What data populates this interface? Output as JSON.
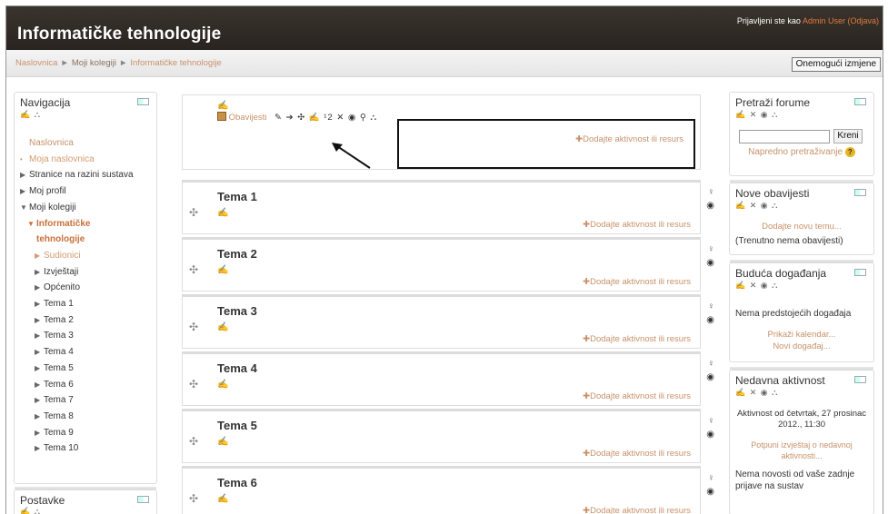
{
  "header": {
    "site_title": "Informatičke tehnologije",
    "login_prefix": "Prijavljeni ste kao",
    "login_user": "Admin User",
    "logout_label": "(Odjava)"
  },
  "navbar": {
    "breadcrumb": [
      "Naslovnica",
      "Moji kolegiji",
      "Informatičke tehnologije"
    ],
    "breadcrumb_sep": "►",
    "edit_button": "Onemogući izmjene"
  },
  "navigation_block": {
    "title": "Navigacija",
    "icons": "✍ ⛬",
    "items": [
      {
        "label": "Naslovnica",
        "indent": 0,
        "marker": "",
        "style": "link"
      },
      {
        "label": "Moja naslovnica",
        "indent": 0,
        "marker": "•",
        "style": "muted"
      },
      {
        "label": "Stranice na razini sustava",
        "indent": 0,
        "marker": "▶",
        "style": "text"
      },
      {
        "label": "Moj profil",
        "indent": 0,
        "marker": "▶",
        "style": "text"
      },
      {
        "label": "Moji kolegiji",
        "indent": 0,
        "marker": "▼",
        "style": "text"
      },
      {
        "label": "Informatičke",
        "indent": 1,
        "marker": "▼",
        "style": "bold-link"
      },
      {
        "label": "tehnologije",
        "indent": 1,
        "marker": "",
        "style": "bold-link"
      },
      {
        "label": "Sudionici",
        "indent": 2,
        "marker": "▶",
        "style": "muted"
      },
      {
        "label": "Izvještaji",
        "indent": 2,
        "marker": "▶",
        "style": "text"
      },
      {
        "label": "Općenito",
        "indent": 2,
        "marker": "▶",
        "style": "text"
      },
      {
        "label": "Tema 1",
        "indent": 2,
        "marker": "▶",
        "style": "text"
      },
      {
        "label": "Tema 2",
        "indent": 2,
        "marker": "▶",
        "style": "text"
      },
      {
        "label": "Tema 3",
        "indent": 2,
        "marker": "▶",
        "style": "text"
      },
      {
        "label": "Tema 4",
        "indent": 2,
        "marker": "▶",
        "style": "text"
      },
      {
        "label": "Tema 5",
        "indent": 2,
        "marker": "▶",
        "style": "text"
      },
      {
        "label": "Tema 6",
        "indent": 2,
        "marker": "▶",
        "style": "text"
      },
      {
        "label": "Tema 7",
        "indent": 2,
        "marker": "▶",
        "style": "text"
      },
      {
        "label": "Tema 8",
        "indent": 2,
        "marker": "▶",
        "style": "text"
      },
      {
        "label": "Tema 9",
        "indent": 2,
        "marker": "▶",
        "style": "text"
      },
      {
        "label": "Tema 10",
        "indent": 2,
        "marker": "▶",
        "style": "text"
      }
    ]
  },
  "settings_block": {
    "title": "Postavke"
  },
  "intro_section": {
    "pencil": "✍",
    "forum_link": "Obavijesti",
    "forum_icons": "✎ ➔ ✣ ✍ ¹2 ✕ ◉ ⚲ ⛬",
    "add_activity": "✚Dodajte aktivnost ili resurs"
  },
  "sections": [
    {
      "title": "Tema 1",
      "add_activity": "✚Dodajte aktivnost ili resurs"
    },
    {
      "title": "Tema 2",
      "add_activity": "✚Dodajte aktivnost ili resurs"
    },
    {
      "title": "Tema 3",
      "add_activity": "✚Dodajte aktivnost ili resurs"
    },
    {
      "title": "Tema 4",
      "add_activity": "✚Dodajte aktivnost ili resurs"
    },
    {
      "title": "Tema 5",
      "add_activity": "✚Dodajte aktivnost ili resurs"
    },
    {
      "title": "Tema 6",
      "add_activity": "✚Dodajte aktivnost ili resurs"
    }
  ],
  "section_icons": {
    "move": "✣",
    "pencil": "✍",
    "highlight": "♀",
    "visibility": "◉"
  },
  "search_forums_block": {
    "title": "Pretraži forume",
    "icons": "✍ ✕ ◉ ⛬",
    "search_button": "Kreni",
    "advanced_link": "Napredno pretraživanje",
    "help_icon": "?"
  },
  "latest_news_block": {
    "title": "Nove obavijesti",
    "icons": "✍ ✕ ◉ ⛬",
    "add_topic": "Dodajte novu temu...",
    "empty_text": "(Trenutno nema obavijesti)"
  },
  "upcoming_events_block": {
    "title": "Buduća događanja",
    "icons": "✍ ✕ ◉ ⛬",
    "empty_text": "Nema predstojećih događaja",
    "calendar_link": "Prikaži kalendar...",
    "new_event_link": "Novi događaj..."
  },
  "recent_activity_block": {
    "title": "Nedavna aktivnost",
    "icons": "✍ ✕ ◉ ⛬",
    "since_text": "Aktivnost od četvrtak, 27 prosinac 2012., 11:30",
    "full_report_link": "Potpuni izvještaj o nedavnoj aktivnosti...",
    "empty_text": "Nema novosti od vaše zadnje prijave na sustav"
  },
  "colors": {
    "header_bg": "#2f2924",
    "link": "#c8916a",
    "accent_orange": "#e07a3a",
    "block_border": "#dddddd"
  }
}
